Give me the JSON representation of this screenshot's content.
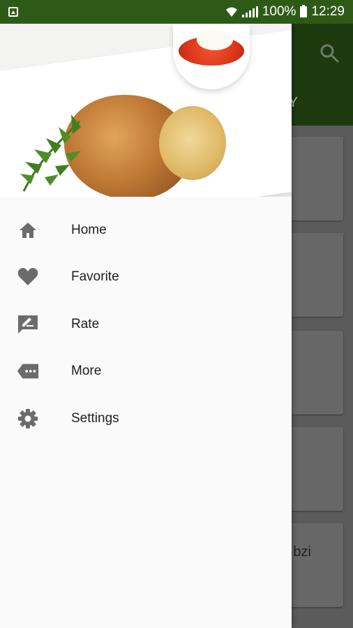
{
  "status_bar": {
    "battery": "100%",
    "time": "12:29"
  },
  "app_background": {
    "tab_label_fragment": "Y",
    "card_text_fragment": "bzi"
  },
  "drawer": {
    "menu": [
      {
        "label": "Home",
        "icon": "home-icon"
      },
      {
        "label": "Favorite",
        "icon": "heart-icon"
      },
      {
        "label": "Rate",
        "icon": "rate-icon"
      },
      {
        "label": "More",
        "icon": "more-icon"
      },
      {
        "label": "Settings",
        "icon": "gear-icon"
      }
    ]
  },
  "colors": {
    "status_bar": "#2e5a18",
    "drawer_bg": "#fafafa",
    "icon": "#6b6b6b",
    "text": "#1e1e1e"
  }
}
